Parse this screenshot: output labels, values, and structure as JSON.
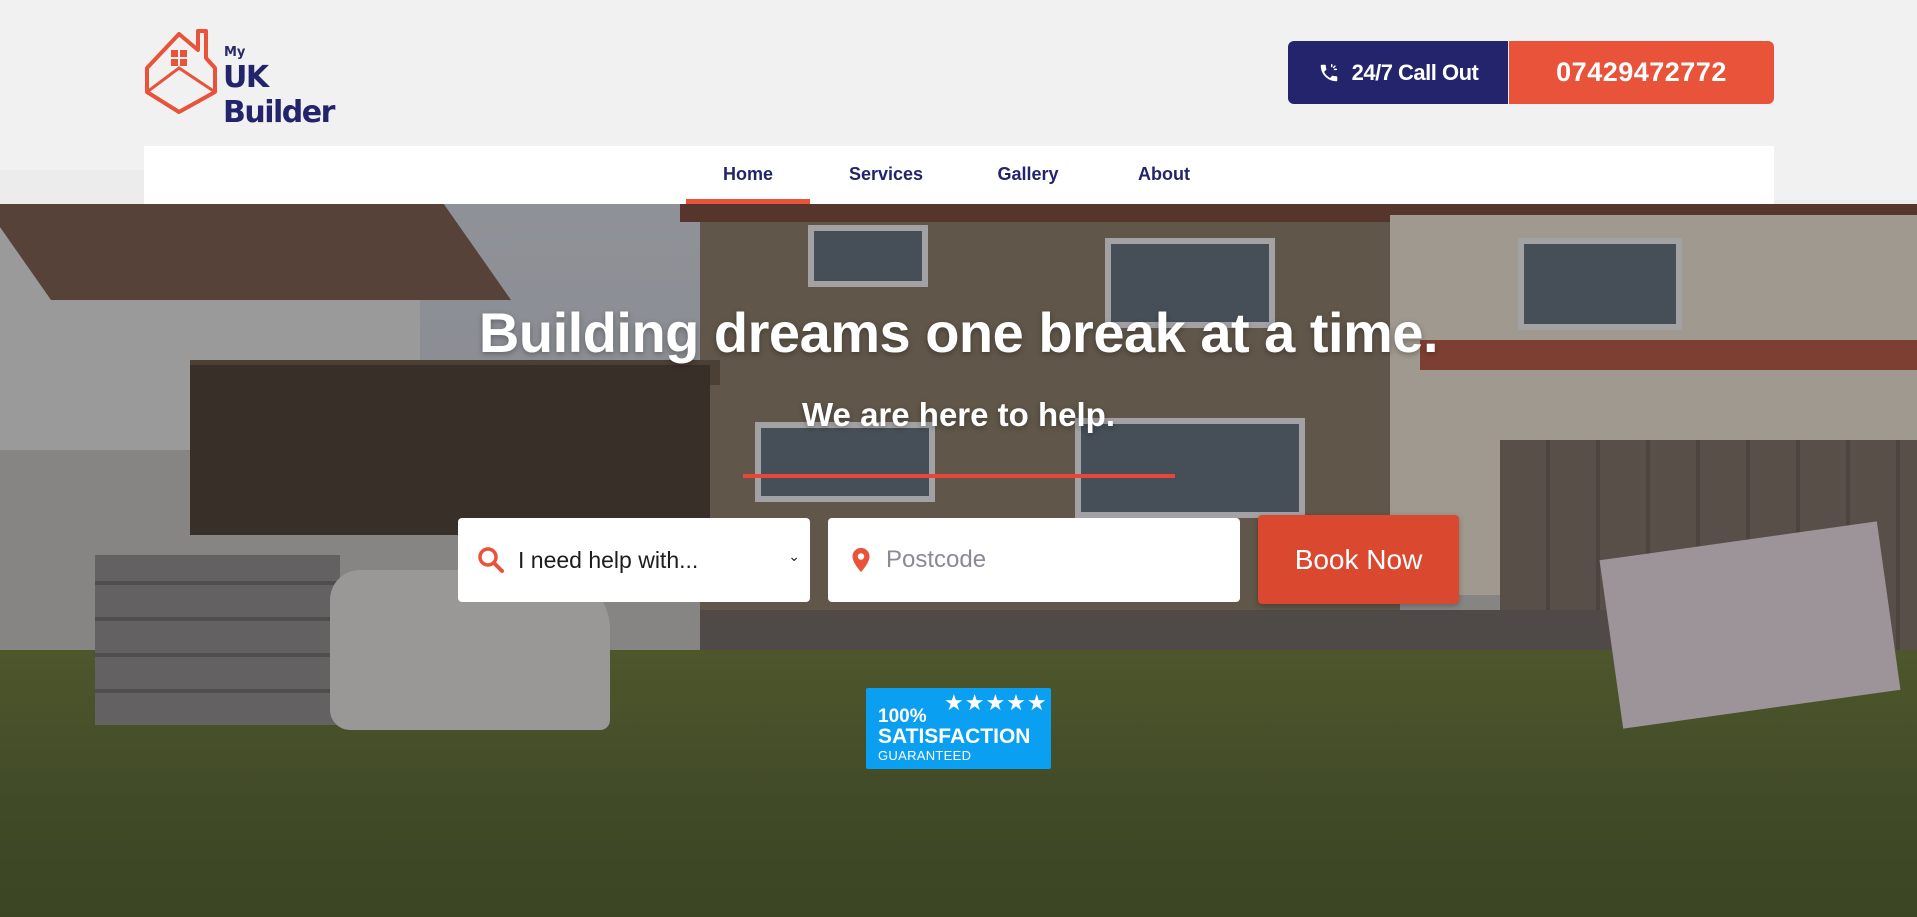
{
  "brand": {
    "logo_small": "My",
    "logo_name": "UK Builder",
    "accent": "#e8533a",
    "navy": "#23246b"
  },
  "header": {
    "callout_label": "24/7 Call Out",
    "callout_icon": "phone-icon",
    "phone_number": "07429472772"
  },
  "nav": {
    "items": [
      {
        "label": "Home",
        "active": true
      },
      {
        "label": "Services",
        "active": false
      },
      {
        "label": "Gallery",
        "active": false
      },
      {
        "label": "About",
        "active": false
      }
    ]
  },
  "hero": {
    "headline": "Building dreams one break at a time.",
    "subline": "We are here to help."
  },
  "search": {
    "select_value": "I need help with...",
    "select_icon": "search-icon",
    "postcode_placeholder": "Postcode",
    "postcode_icon": "location-pin-icon",
    "submit_label": "Book Now"
  },
  "badge": {
    "percent": "100%",
    "stars": "★★★★★",
    "title": "SATISFACTION",
    "subtitle": "GUARANTEED",
    "color": "#0a9ff0"
  }
}
